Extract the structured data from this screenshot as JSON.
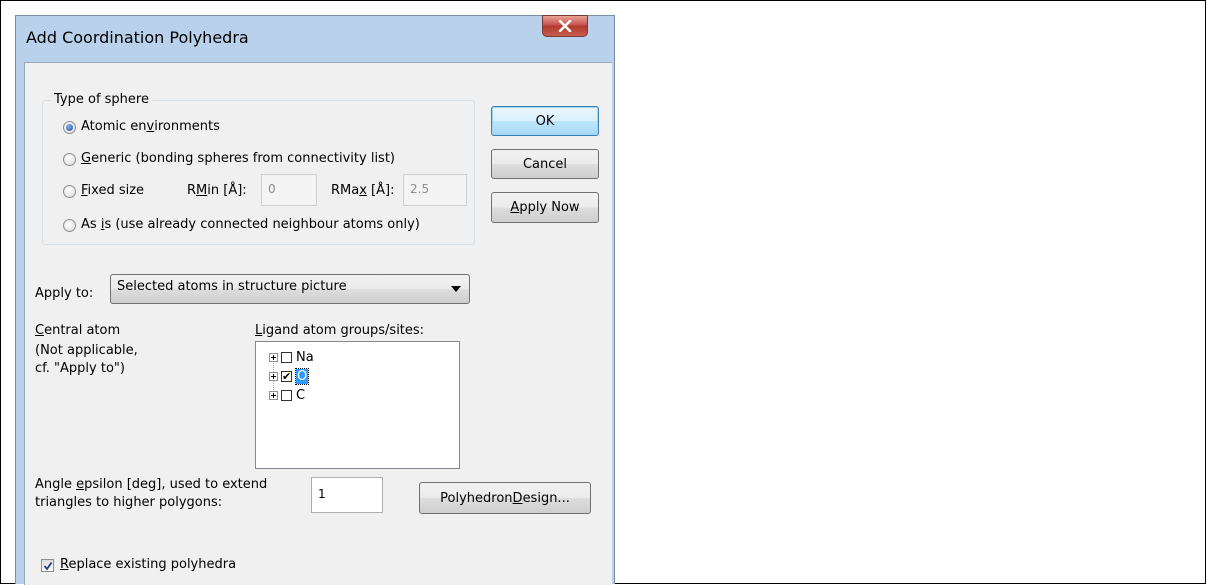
{
  "dialog": {
    "title": "Add Coordination Polyhedra",
    "close_icon": "close-x-icon"
  },
  "sphere": {
    "group_label": "Type of sphere",
    "options": [
      {
        "pre": "Atomic en",
        "mn": "v",
        "post": "ironments",
        "checked": true
      },
      {
        "pre": "",
        "mn": "G",
        "post": "eneric (bonding spheres from connectivity list)",
        "checked": false
      },
      {
        "pre": "",
        "mn": "F",
        "post": "ixed size",
        "checked": false
      },
      {
        "pre": "As ",
        "mn": "i",
        "post": "s (use already connected neighbour atoms only)",
        "checked": false
      }
    ],
    "rmin_label_pre": "R",
    "rmin_label_mn": "M",
    "rmin_label_post": "in [Å]:",
    "rmin_value": "0",
    "rmax_label_pre": "RMa",
    "rmax_label_mn": "x",
    "rmax_label_post": " [Å]:",
    "rmax_value": "2.5"
  },
  "buttons": {
    "ok": "OK",
    "cancel": "Cancel",
    "apply_mn": "A",
    "apply_rest": "pply Now",
    "polyhedron_pre": "Polyhedron ",
    "polyhedron_mn": "D",
    "polyhedron_post": "esign..."
  },
  "apply_to": {
    "label": "Apply to:",
    "selected": "Selected atoms in structure picture"
  },
  "central_atom": {
    "label_mn": "C",
    "label_rest": "entral atom",
    "note_line1": "(Not applicable,",
    "note_line2": "cf. \"Apply to\")"
  },
  "ligands": {
    "label_mn": "L",
    "label_rest": "igand atom groups/sites:",
    "items": [
      {
        "name": "Na",
        "checked": false,
        "selected": false
      },
      {
        "name": "O",
        "checked": true,
        "selected": true
      },
      {
        "name": "C",
        "checked": false,
        "selected": false
      }
    ]
  },
  "angle": {
    "line1_pre": "Angle ",
    "line1_mn": "e",
    "line1_post": "psilon [deg], used to extend",
    "line2": "triangles to higher polygons:",
    "value": "1"
  },
  "replace": {
    "mn": "R",
    "rest": "eplace existing polyhedra",
    "checked": true
  }
}
